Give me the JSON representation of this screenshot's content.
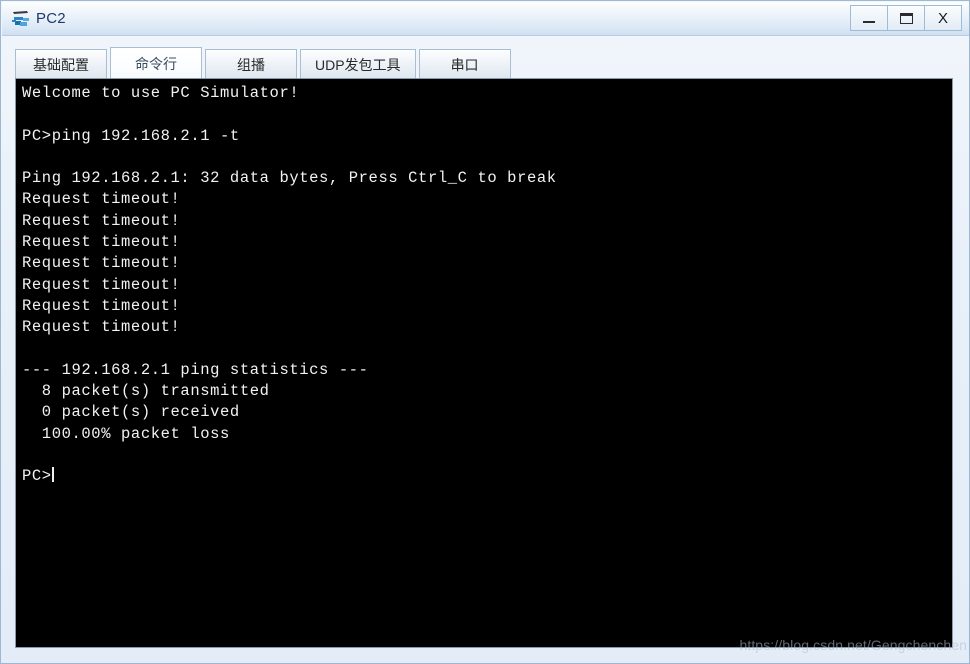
{
  "window": {
    "title": "PC2",
    "icon": "pc-device-icon",
    "controls": [
      {
        "name": "minimize-button",
        "label": "–"
      },
      {
        "name": "maximize-button",
        "label": "❑"
      },
      {
        "name": "close-button",
        "label": "X"
      }
    ]
  },
  "tabs": [
    {
      "label": "基础配置",
      "active": false
    },
    {
      "label": "命令行",
      "active": true
    },
    {
      "label": "组播",
      "active": false
    },
    {
      "label": "UDP发包工具",
      "active": false
    },
    {
      "label": "串口",
      "active": false
    }
  ],
  "terminal": {
    "lines": [
      "Welcome to use PC Simulator!",
      "",
      "PC>ping 192.168.2.1 -t",
      "",
      "Ping 192.168.2.1: 32 data bytes, Press Ctrl_C to break",
      "Request timeout!",
      "Request timeout!",
      "Request timeout!",
      "Request timeout!",
      "Request timeout!",
      "Request timeout!",
      "Request timeout!",
      "",
      "--- 192.168.2.1 ping statistics ---",
      "  8 packet(s) transmitted",
      "  0 packet(s) received",
      "  100.00% packet loss",
      "",
      "PC>"
    ],
    "prompt_line_index": 18,
    "cursor_visible": true,
    "background_color": "#000000",
    "text_color": "#f2f2f2"
  },
  "watermark": {
    "text": "https://blog.csdn.net/Gengchenchen"
  }
}
